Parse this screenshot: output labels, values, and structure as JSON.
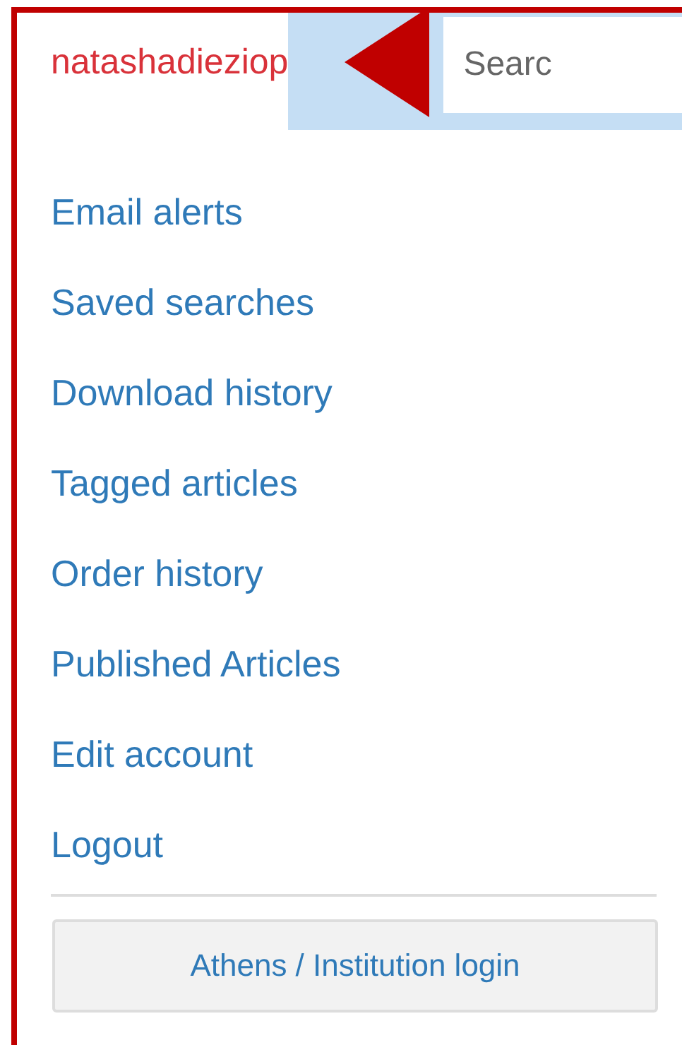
{
  "header": {
    "username": "natashadieziop",
    "search": {
      "placeholder": "Searc"
    }
  },
  "menu": [
    {
      "label": "Email alerts"
    },
    {
      "label": "Saved searches"
    },
    {
      "label": "Download history"
    },
    {
      "label": "Tagged articles"
    },
    {
      "label": "Order history"
    },
    {
      "label": "Published Articles"
    },
    {
      "label": "Edit account"
    },
    {
      "label": "Logout"
    }
  ],
  "login_button": "Athens / Institution login"
}
